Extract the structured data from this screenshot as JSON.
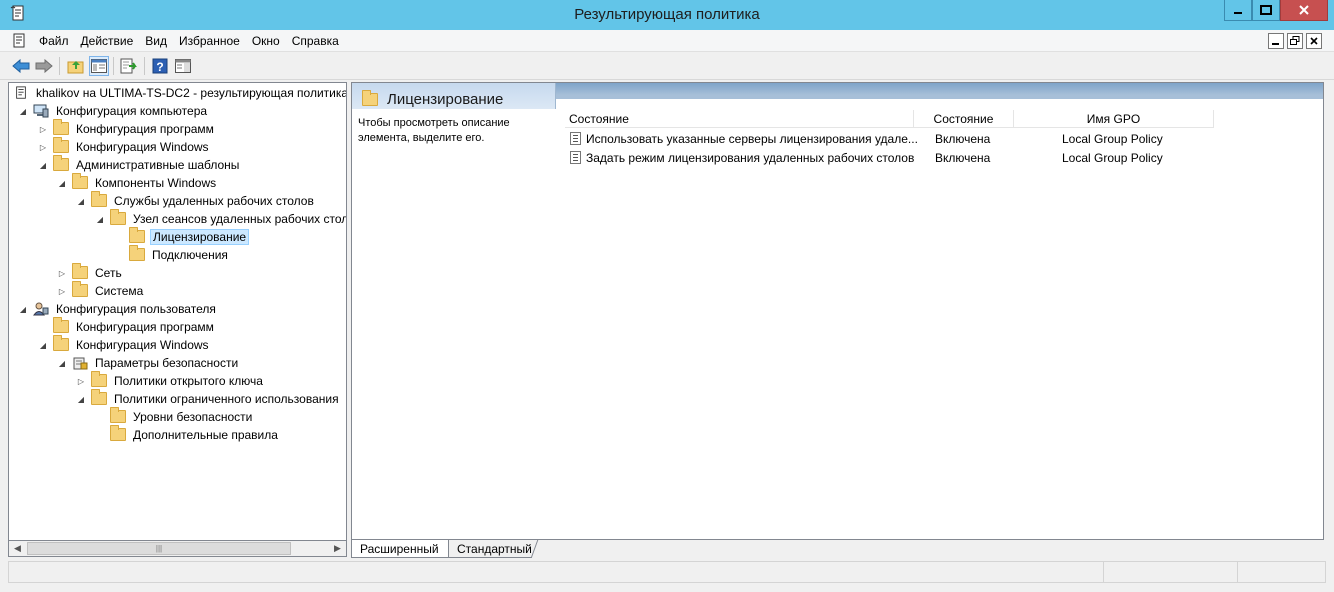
{
  "window": {
    "title": "Результирующая политика"
  },
  "menu": {
    "items": [
      "Файл",
      "Действие",
      "Вид",
      "Избранное",
      "Окно",
      "Справка"
    ]
  },
  "tree": {
    "root": "khalikov на ULTIMA-TS-DC2 - результирующая политика",
    "nodes": [
      {
        "label": "Конфигурация компьютера",
        "icon": "computer-icon",
        "expander": "open"
      },
      {
        "label": "Конфигурация программ",
        "icon": "folder-icon",
        "expander": "closed"
      },
      {
        "label": "Конфигурация Windows",
        "icon": "folder-icon",
        "expander": "closed"
      },
      {
        "label": "Административные шаблоны",
        "icon": "folder-icon",
        "expander": "open"
      },
      {
        "label": "Компоненты Windows",
        "icon": "folder-icon",
        "expander": "open"
      },
      {
        "label": "Службы удаленных рабочих столов",
        "icon": "folder-icon",
        "expander": "open"
      },
      {
        "label": "Узел сеансов удаленных рабочих столов",
        "icon": "folder-icon",
        "expander": "open"
      },
      {
        "label": "Лицензирование",
        "icon": "folder-icon",
        "expander": "none",
        "selected": true
      },
      {
        "label": "Подключения",
        "icon": "folder-icon",
        "expander": "none"
      },
      {
        "label": "Сеть",
        "icon": "folder-icon",
        "expander": "closed"
      },
      {
        "label": "Система",
        "icon": "folder-icon",
        "expander": "closed"
      },
      {
        "label": "Конфигурация пользователя",
        "icon": "users-icon",
        "expander": "open"
      },
      {
        "label": "Конфигурация программ",
        "icon": "folder-icon",
        "expander": "none"
      },
      {
        "label": "Конфигурация Windows",
        "icon": "folder-icon",
        "expander": "open"
      },
      {
        "label": "Параметры безопасности",
        "icon": "security-icon",
        "expander": "open"
      },
      {
        "label": "Политики открытого ключа",
        "icon": "folder-icon",
        "expander": "closed"
      },
      {
        "label": "Политики ограниченного использования",
        "icon": "folder-icon",
        "expander": "open"
      },
      {
        "label": "Уровни безопасности",
        "icon": "folder-icon",
        "expander": "none"
      },
      {
        "label": "Дополнительные правила",
        "icon": "folder-icon",
        "expander": "none"
      }
    ]
  },
  "details": {
    "title": "Лицензирование",
    "description": "Чтобы просмотреть описание элемента, выделите его.",
    "columns": [
      "Состояние",
      "Состояние",
      "Имя GPO"
    ],
    "rows": [
      {
        "name": "Использовать указанные серверы лицензирования удале...",
        "state": "Включена",
        "gpo": "Local Group Policy"
      },
      {
        "name": "Задать режим лицензирования удаленных рабочих столов",
        "state": "Включена",
        "gpo": "Local Group Policy"
      }
    ]
  },
  "tabs": {
    "extended": "Расширенный",
    "standard": "Стандартный"
  },
  "colors": {
    "titlebar": "#62c5e8",
    "close": "#c75050",
    "selection": "#cce8ff",
    "folder": "#f5d27a"
  }
}
